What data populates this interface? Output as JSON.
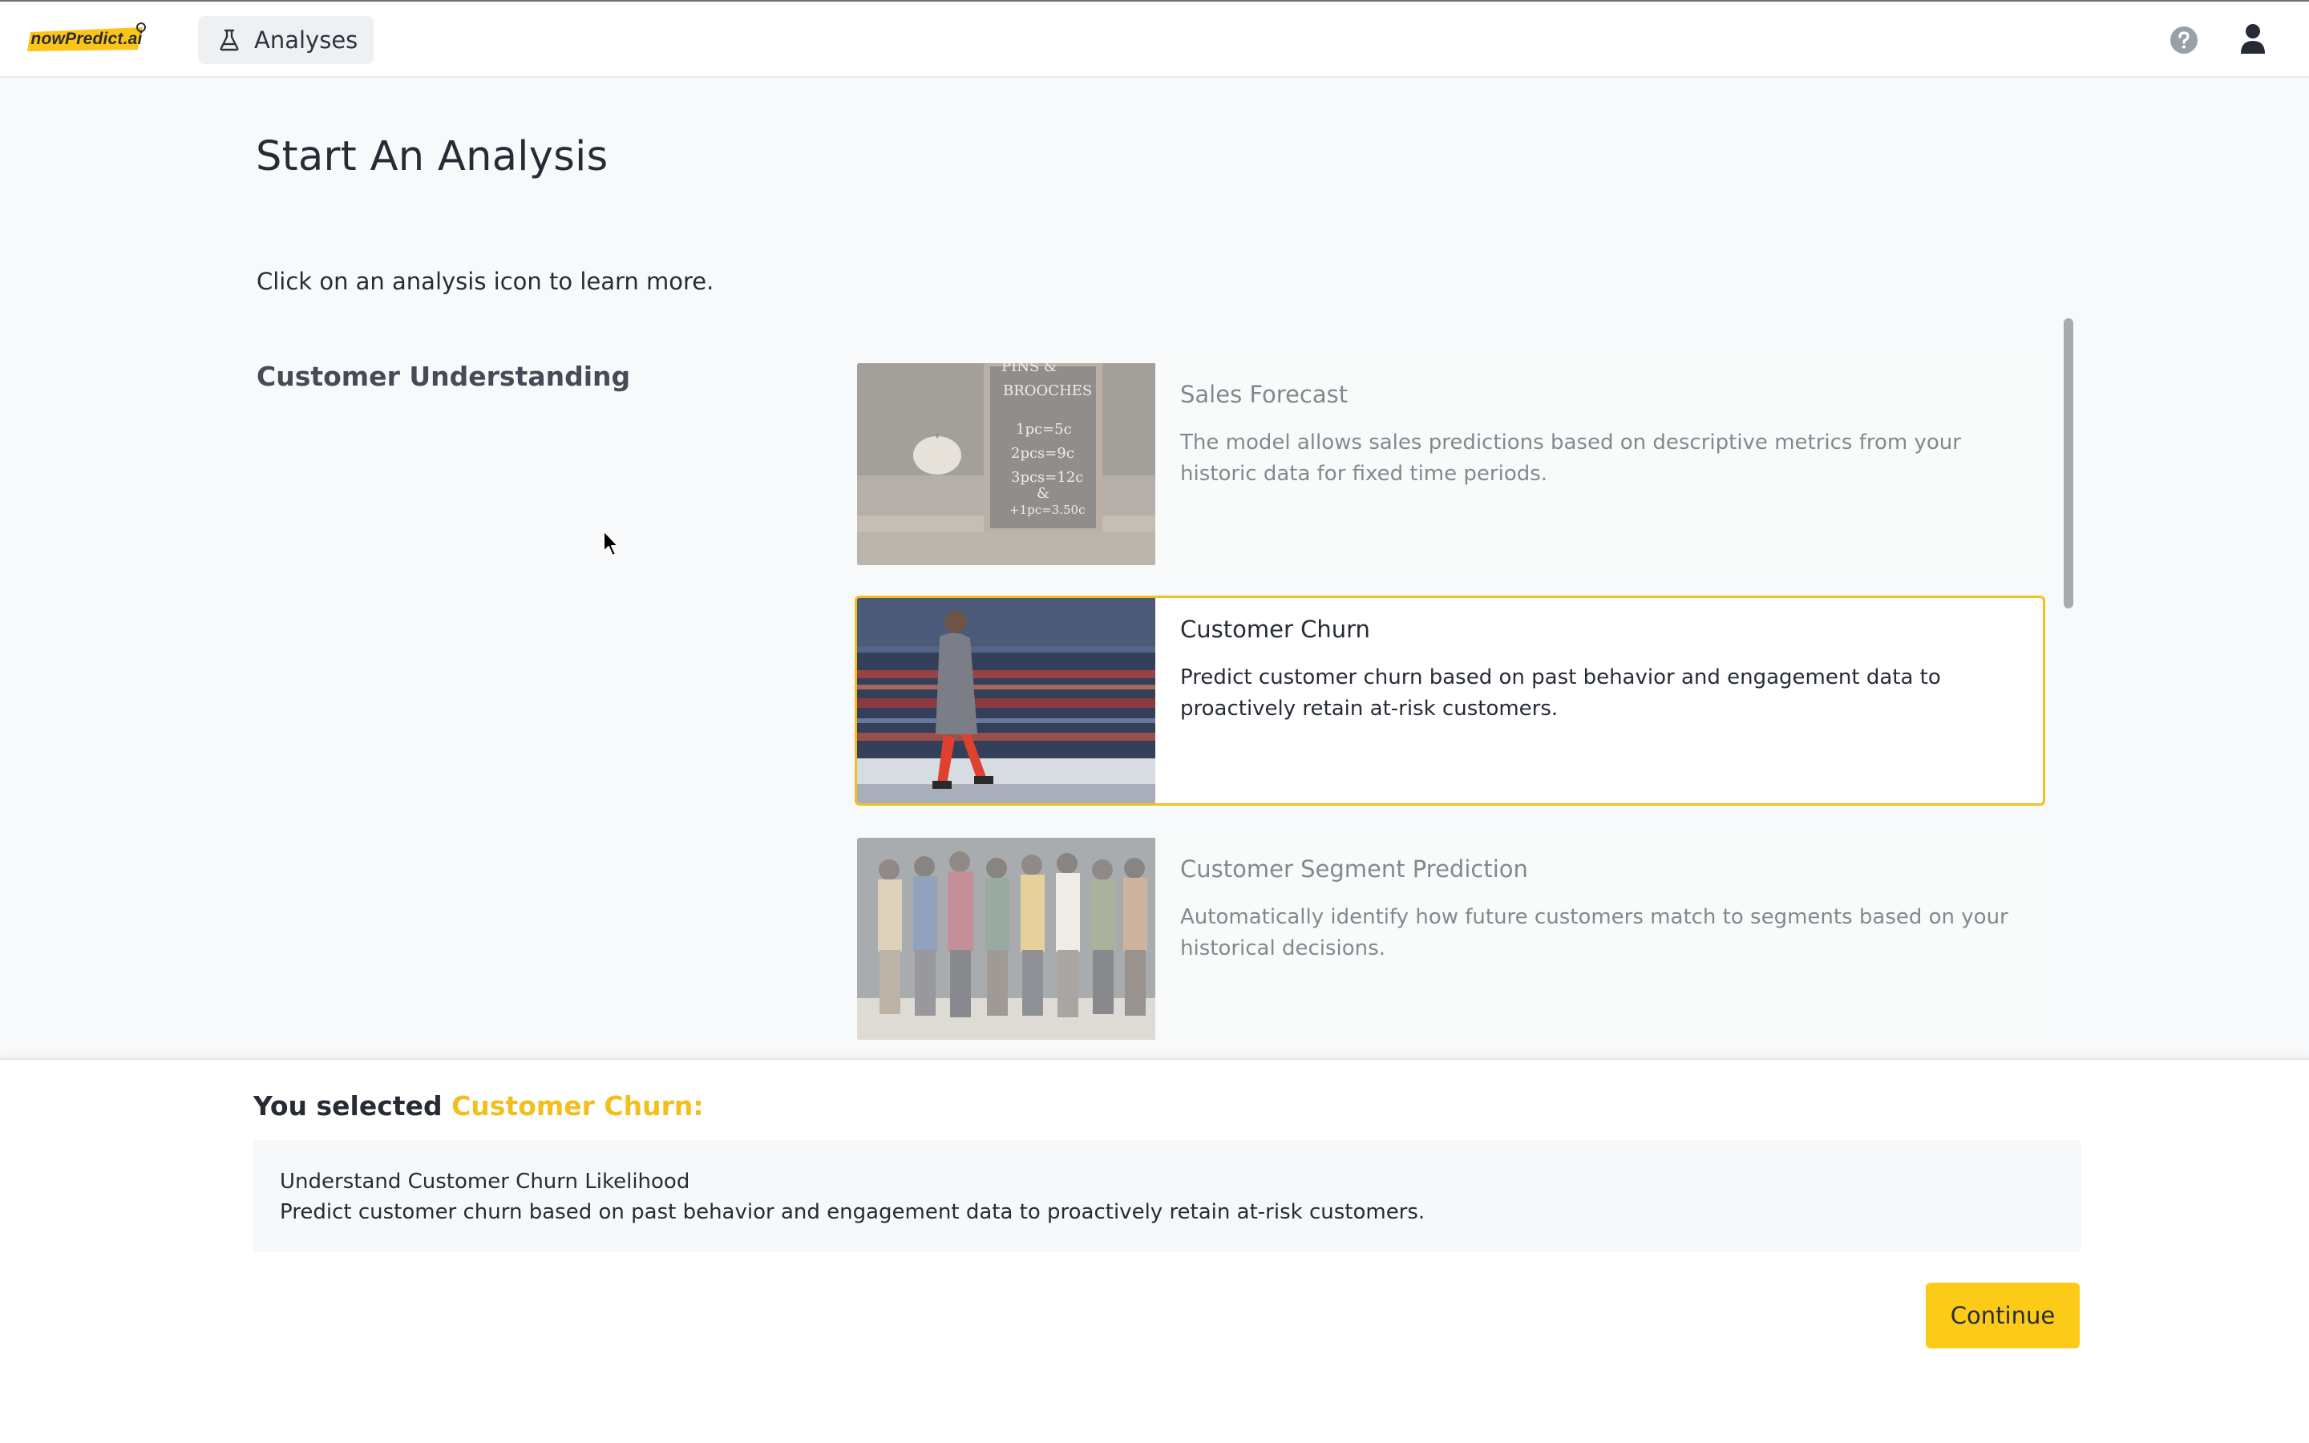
{
  "header": {
    "logo_text": "nowPredict.ai",
    "nav_label": "Analyses",
    "icons": [
      "flask-icon",
      "help-icon",
      "user-icon"
    ]
  },
  "page": {
    "title": "Start An Analysis",
    "intro": "Click on an analysis icon to learn more.",
    "section_title": "Customer Understanding"
  },
  "cards": [
    {
      "title": "Sales Forecast",
      "description": "The model allows sales predictions based on descriptive metrics from your historic data for fixed time periods.",
      "state": "dimmed",
      "image": "chalkboard-price-sign-image",
      "image_text": [
        "PINS &",
        "BROOCHES",
        "1pc=5c",
        "2pcs=9c",
        "3pcs=12c",
        "&",
        "+1pc=3.50c"
      ]
    },
    {
      "title": "Customer Churn",
      "description": "Predict customer churn based on past behavior and engagement data to proactively retain at-risk customers.",
      "state": "selected",
      "image": "woman-walking-with-phone-image"
    },
    {
      "title": "Customer Segment Prediction",
      "description": "Automatically identify how future customers match to segments based on your historical decisions.",
      "state": "dimmed",
      "image": "group-of-people-embracing-image"
    }
  ],
  "selection": {
    "prefix": "You selected",
    "name": "Customer Churn:",
    "summary_title": "Understand Customer Churn Likelihood",
    "summary_desc": "Predict customer churn based on past behavior and engagement data to proactively retain at-risk customers."
  },
  "actions": {
    "continue_label": "Continue"
  },
  "colors": {
    "accent": "#fccb18",
    "accent_text": "#f2c01d",
    "text": "#262b36",
    "background": "#f8f9fa"
  }
}
